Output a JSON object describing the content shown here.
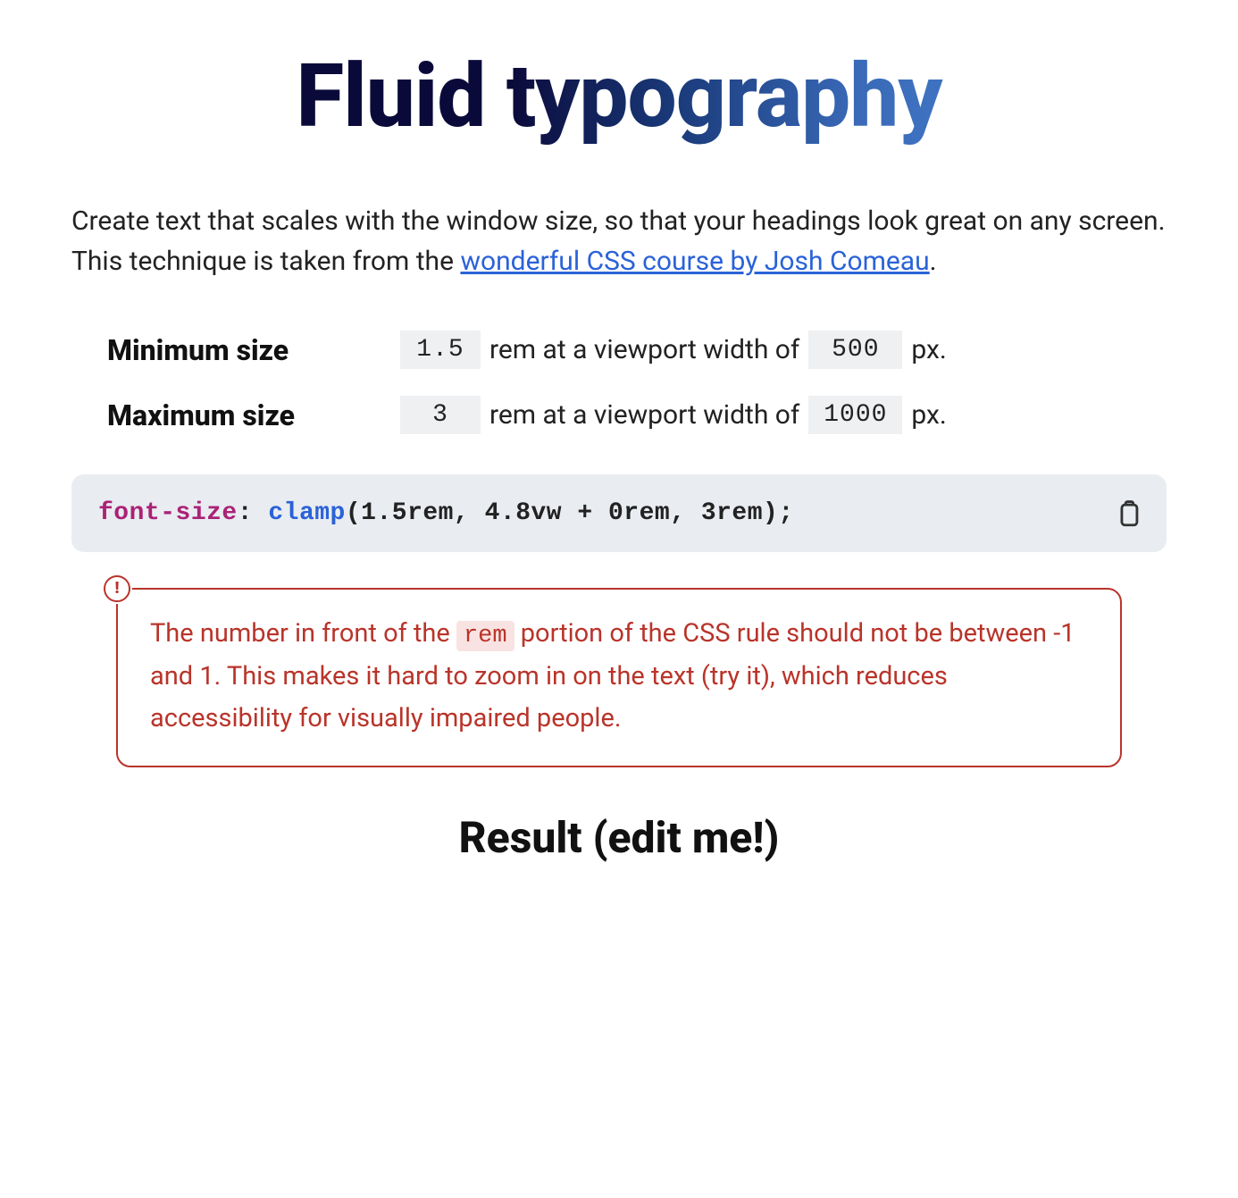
{
  "title": "Fluid typography",
  "intro": {
    "text_before_link": "Create text that scales with the window size, so that your headings look great on any screen. This technique is taken from the ",
    "link_text": "wonderful CSS course by Josh Comeau",
    "text_after_link": "."
  },
  "controls": {
    "min": {
      "label": "Minimum size",
      "size_value": "1.5",
      "size_unit_text": "rem at a viewport width of",
      "vw_value": "500",
      "vw_unit_text": "px."
    },
    "max": {
      "label": "Maximum size",
      "size_value": "3",
      "size_unit_text": "rem at a viewport width of",
      "vw_value": "1000",
      "vw_unit_text": "px."
    }
  },
  "code": {
    "property": "font-size",
    "colon": ": ",
    "func": "clamp",
    "args_rest": "(1.5rem, 4.8vw + 0rem, 3rem);"
  },
  "warning": {
    "part1": "The number in front of the ",
    "code_token": "rem",
    "part2": " portion of the CSS rule should not be between -1 and 1. This makes it hard to zoom in on the text (try it), which reduces accessibility for visually impaired people."
  },
  "result_heading": "Result (edit me!)"
}
